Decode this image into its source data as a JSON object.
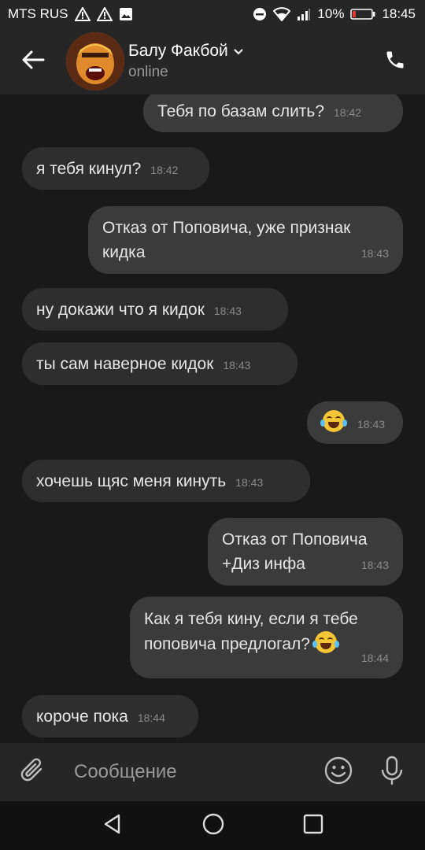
{
  "status_bar": {
    "carrier": "MTS RUS",
    "battery_percent": "10%",
    "time": "18:45"
  },
  "header": {
    "contact_name": "Балу Факбой",
    "status": "online"
  },
  "messages": [
    {
      "dir": "out",
      "text": "Тебя по базам слить?",
      "time": "18:42"
    },
    {
      "dir": "in",
      "text": "я тебя кинул?",
      "time": "18:42"
    },
    {
      "dir": "out",
      "text": "Отказ от Поповича, уже признак кидка",
      "time": "18:43"
    },
    {
      "dir": "in",
      "text": "ну докажи что я кидок",
      "time": "18:43"
    },
    {
      "dir": "in",
      "text": "ты сам наверное кидок",
      "time": "18:43"
    },
    {
      "dir": "out",
      "text": "",
      "emoji": "face-with-tears-of-joy",
      "time": "18:43"
    },
    {
      "dir": "in",
      "text": "хочешь щяс меня кинуть",
      "time": "18:43"
    },
    {
      "dir": "out",
      "text": "Отказ от Поповича +Диз инфа",
      "time": "18:43"
    },
    {
      "dir": "out",
      "text": "Как я тебя кину, если я тебе поповича предлогал?",
      "emoji": "face-with-tears-of-joy",
      "time": "18:44"
    },
    {
      "dir": "in",
      "text": "короче пока",
      "time": "18:44"
    }
  ],
  "composer": {
    "placeholder": "Сообщение"
  },
  "icons": {
    "back": "arrow-left-icon",
    "call": "phone-icon",
    "attach": "paperclip-icon",
    "emoji": "smiley-icon",
    "mic": "microphone-icon",
    "nav_back": "triangle-back-icon",
    "nav_home": "circle-home-icon",
    "nav_recent": "square-recent-icon"
  },
  "colors": {
    "background": "#191919",
    "bar": "#262626",
    "bubble_in": "#2e2e2e",
    "bubble_out": "#3b3b3b"
  }
}
